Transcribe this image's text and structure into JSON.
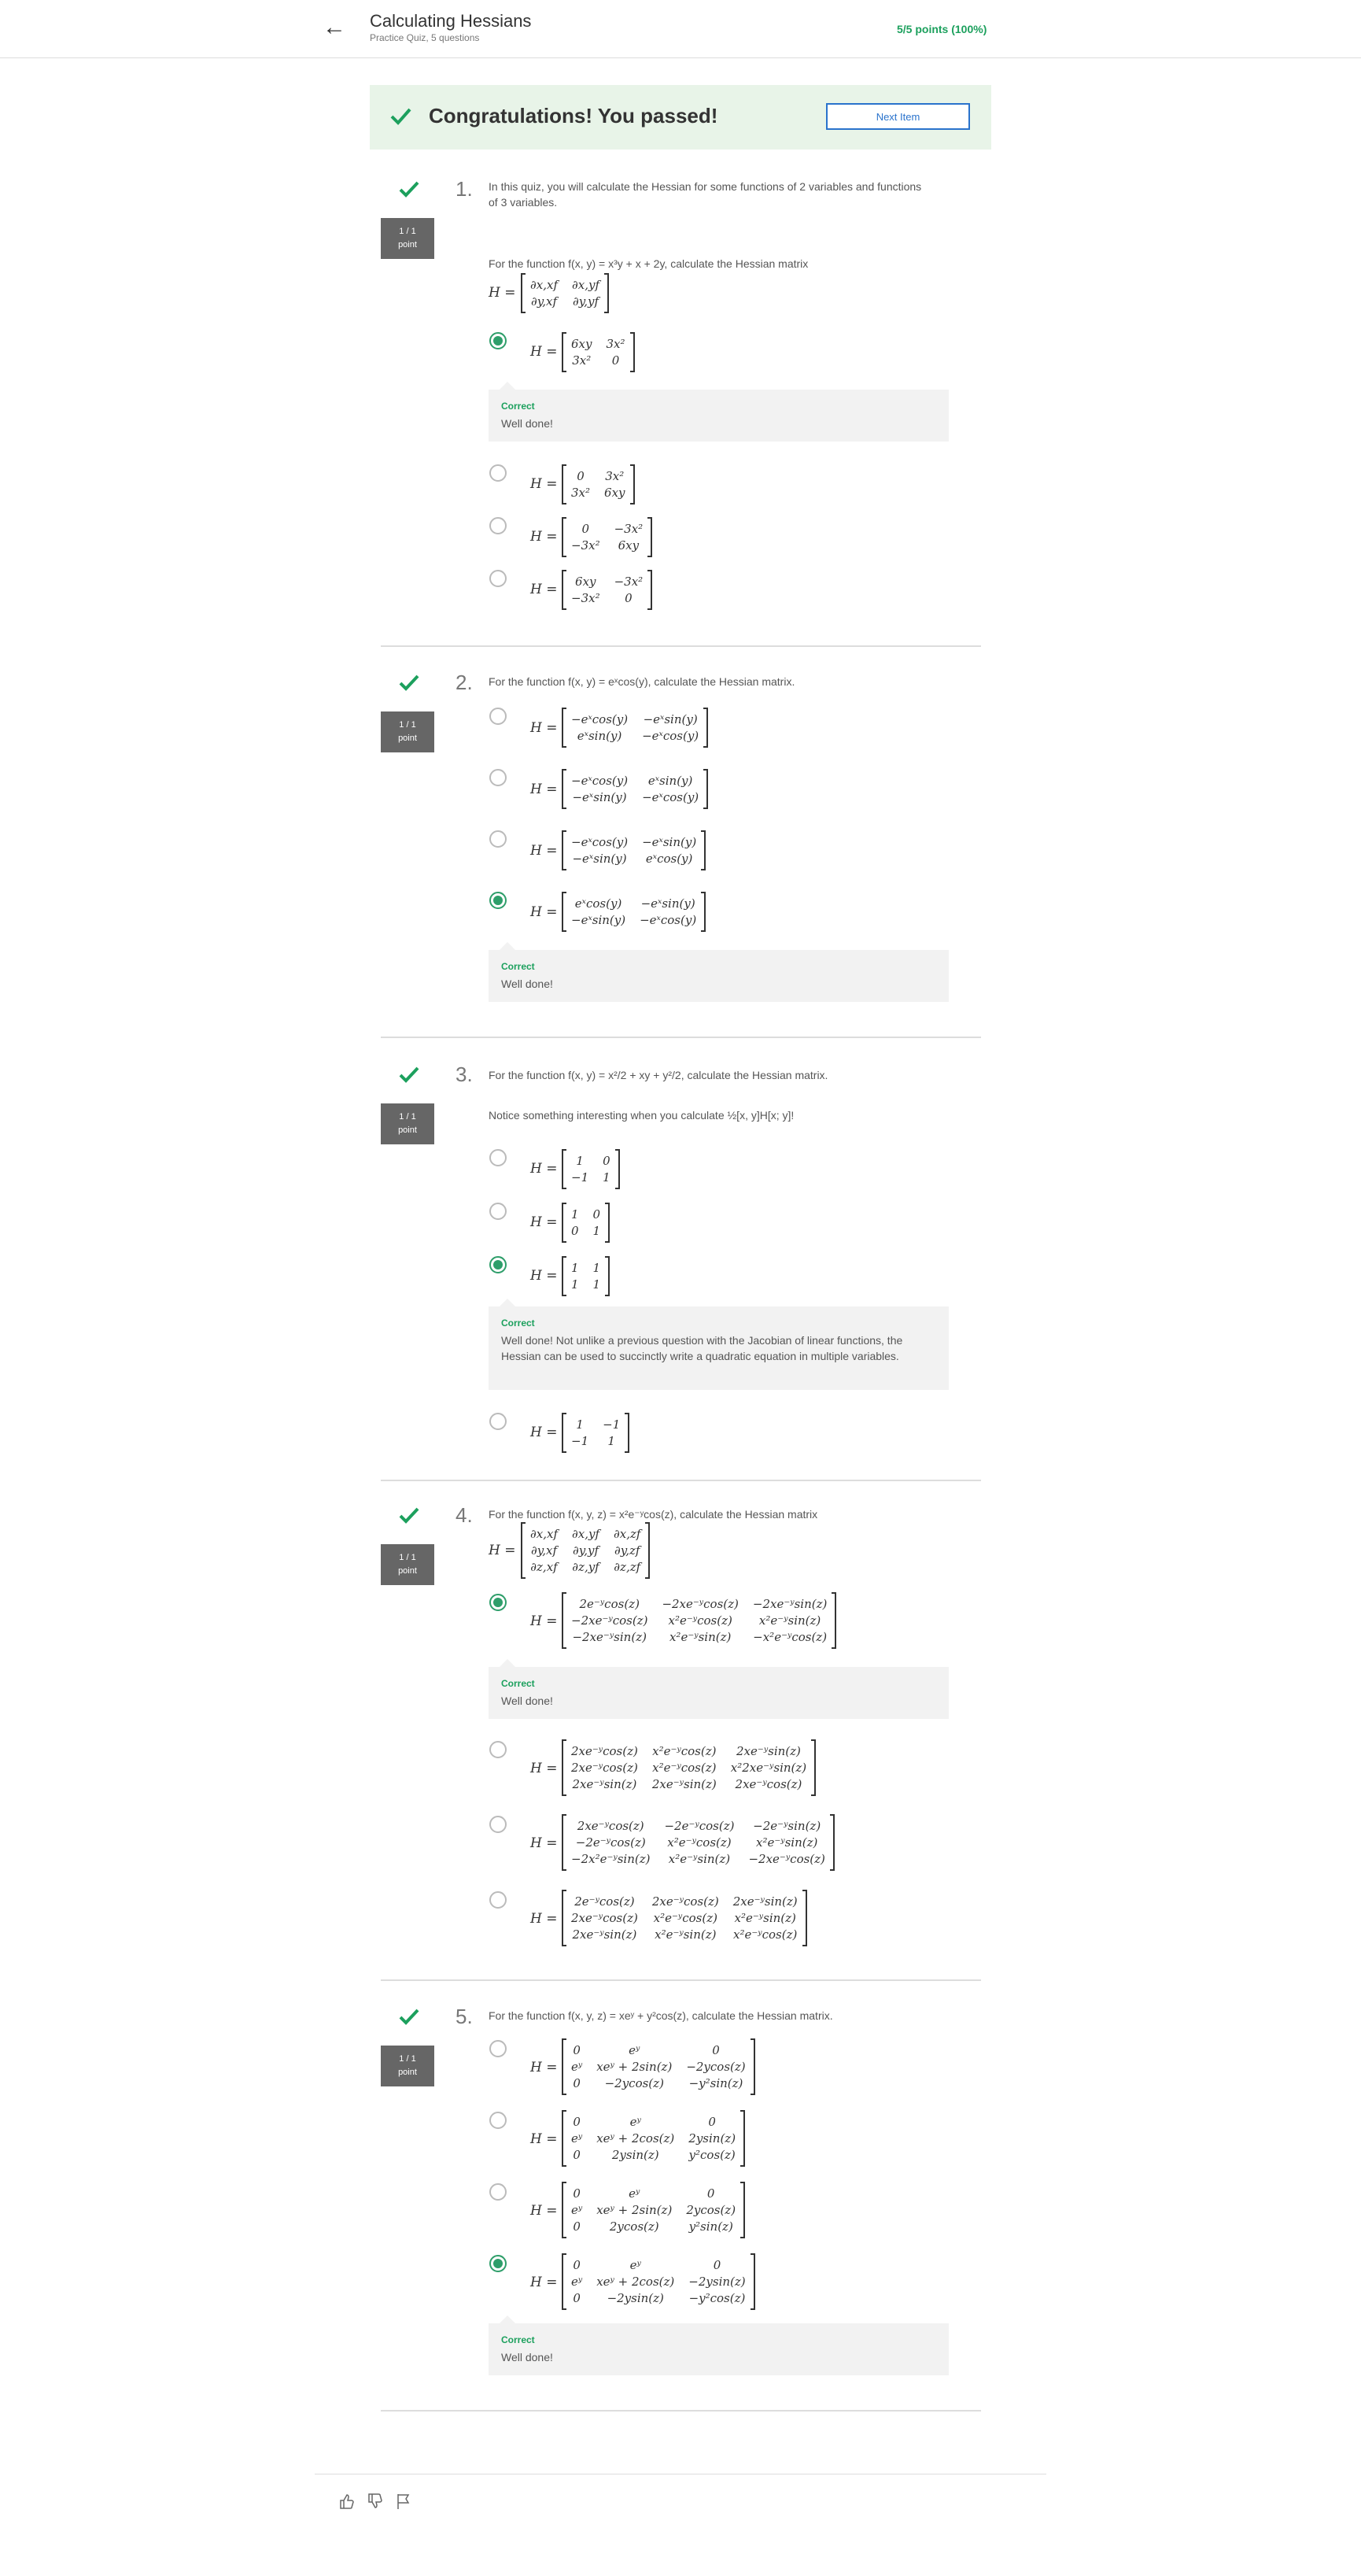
{
  "header": {
    "back_icon": "arrow-left-icon",
    "title": "Calculating Hessians",
    "subtitle": "Practice Quiz, 5 questions",
    "score": "5/5 points (100%)"
  },
  "banner": {
    "icon": "check-icon",
    "message": "Congratulations! You passed!",
    "next_label": "Next Item"
  },
  "colors": {
    "success": "#1ca05d",
    "accent": "#2a73cc",
    "banner_bg": "#e8f4e8"
  },
  "questions": [
    {
      "number": "1.",
      "points": [
        "1 / 1",
        "point"
      ],
      "intro": "In this quiz, you will calculate the Hessian for some functions of 2 variables and functions",
      "intro2": "of 3 variables.",
      "prompt": "For the function f(x, y) = x³y + x + 2y, calculate the Hessian matrix",
      "hessian_def": [
        "∂x,xf",
        "∂x,yf",
        "∂y,xf",
        "∂y,yf"
      ],
      "options": [
        {
          "cells": [
            "6xy",
            "3x²",
            "3x²",
            "0"
          ]
        },
        {
          "cells": [
            "0",
            "3x²",
            "3x²",
            "6xy"
          ]
        },
        {
          "cells": [
            "0",
            "−3x²",
            "−3x²",
            "6xy"
          ]
        },
        {
          "cells": [
            "6xy",
            "−3x²",
            "−3x²",
            "0"
          ]
        }
      ],
      "feedback": {
        "title": "Correct",
        "text": "Well done!"
      }
    },
    {
      "number": "2.",
      "points": [
        "1 / 1",
        "point"
      ],
      "prompt": "For the function f(x, y) = eˣcos(y), calculate the Hessian matrix.",
      "options": [
        {
          "cells": [
            "−eˣcos(y)",
            "−eˣsin(y)",
            "eˣsin(y)",
            "−eˣcos(y)"
          ]
        },
        {
          "cells": [
            "−eˣcos(y)",
            "eˣsin(y)",
            "−eˣsin(y)",
            "−eˣcos(y)"
          ]
        },
        {
          "cells": [
            "−eˣcos(y)",
            "−eˣsin(y)",
            "−eˣsin(y)",
            "eˣcos(y)"
          ]
        },
        {
          "cells": [
            "eˣcos(y)",
            "−eˣsin(y)",
            "−eˣsin(y)",
            "−eˣcos(y)"
          ]
        }
      ],
      "feedback": {
        "title": "Correct",
        "text": "Well done!"
      }
    },
    {
      "number": "3.",
      "points": [
        "1 / 1",
        "point"
      ],
      "prompt": "For the function f(x, y) = x²/2 + xy + y²/2, calculate the Hessian matrix.",
      "prompt2": "Notice something interesting when you calculate ½[x, y]H[x; y]!",
      "options": [
        {
          "cells": [
            "1",
            "0",
            "−1",
            "1"
          ]
        },
        {
          "cells": [
            "1",
            "0",
            "0",
            "1"
          ]
        },
        {
          "cells": [
            "1",
            "1",
            "1",
            "1"
          ]
        },
        {
          "cells": [
            "1",
            "−1",
            "−1",
            "1"
          ]
        }
      ],
      "feedback": {
        "title": "Correct",
        "text": "Well done! Not unlike a previous question with the Jacobian of linear functions, the Hessian can be used to succinctly write a quadratic equation in multiple variables."
      }
    },
    {
      "number": "4.",
      "points": [
        "1 / 1",
        "point"
      ],
      "prompt": "For the function f(x, y, z) = x²e⁻ʸcos(z), calculate the Hessian matrix",
      "hessian_def": [
        "∂x,xf",
        "∂x,yf",
        "∂x,zf",
        "∂y,xf",
        "∂y,yf",
        "∂y,zf",
        "∂z,xf",
        "∂z,yf",
        "∂z,zf"
      ],
      "options": [
        {
          "cells": [
            "2e⁻ʸcos(z)",
            "−2xe⁻ʸcos(z)",
            "−2xe⁻ʸsin(z)",
            "−2xe⁻ʸcos(z)",
            "x²e⁻ʸcos(z)",
            "x²e⁻ʸsin(z)",
            "−2xe⁻ʸsin(z)",
            "x²e⁻ʸsin(z)",
            "−x²e⁻ʸcos(z)"
          ]
        },
        {
          "cells": [
            "2xe⁻ʸcos(z)",
            "x²e⁻ʸcos(z)",
            "2xe⁻ʸsin(z)",
            "2xe⁻ʸcos(z)",
            "x²e⁻ʸcos(z)",
            "x²2xe⁻ʸsin(z)",
            "2xe⁻ʸsin(z)",
            "2xe⁻ʸsin(z)",
            "2xe⁻ʸcos(z)"
          ]
        },
        {
          "cells": [
            "2xe⁻ʸcos(z)",
            "−2e⁻ʸcos(z)",
            "−2e⁻ʸsin(z)",
            "−2e⁻ʸcos(z)",
            "x²e⁻ʸcos(z)",
            "x²e⁻ʸsin(z)",
            "−2x²e⁻ʸsin(z)",
            "x²e⁻ʸsin(z)",
            "−2xe⁻ʸcos(z)"
          ]
        },
        {
          "cells": [
            "2e⁻ʸcos(z)",
            "2xe⁻ʸcos(z)",
            "2xe⁻ʸsin(z)",
            "2xe⁻ʸcos(z)",
            "x²e⁻ʸcos(z)",
            "x²e⁻ʸsin(z)",
            "2xe⁻ʸsin(z)",
            "x²e⁻ʸsin(z)",
            "x²e⁻ʸcos(z)"
          ]
        }
      ],
      "feedback": {
        "title": "Correct",
        "text": "Well done!"
      }
    },
    {
      "number": "5.",
      "points": [
        "1 / 1",
        "point"
      ],
      "prompt": "For the function f(x, y, z) = xeʸ + y²cos(z), calculate the Hessian matrix.",
      "options": [
        {
          "cells": [
            "0",
            "eʸ",
            "0",
            "eʸ",
            "xeʸ + 2sin(z)",
            "−2ycos(z)",
            "0",
            "−2ycos(z)",
            "−y²sin(z)"
          ]
        },
        {
          "cells": [
            "0",
            "eʸ",
            "0",
            "eʸ",
            "xeʸ + 2cos(z)",
            "2ysin(z)",
            "0",
            "2ysin(z)",
            "y²cos(z)"
          ]
        },
        {
          "cells": [
            "0",
            "eʸ",
            "0",
            "eʸ",
            "xeʸ + 2sin(z)",
            "2ycos(z)",
            "0",
            "2ycos(z)",
            "y²sin(z)"
          ]
        },
        {
          "cells": [
            "0",
            "eʸ",
            "0",
            "eʸ",
            "xeʸ + 2cos(z)",
            "−2ysin(z)",
            "0",
            "−2ysin(z)",
            "−y²cos(z)"
          ]
        }
      ],
      "feedback": {
        "title": "Correct",
        "text": "Well done!"
      }
    }
  ],
  "footer": {
    "icons": [
      "thumbs-up-icon",
      "thumbs-down-icon",
      "flag-icon"
    ]
  }
}
